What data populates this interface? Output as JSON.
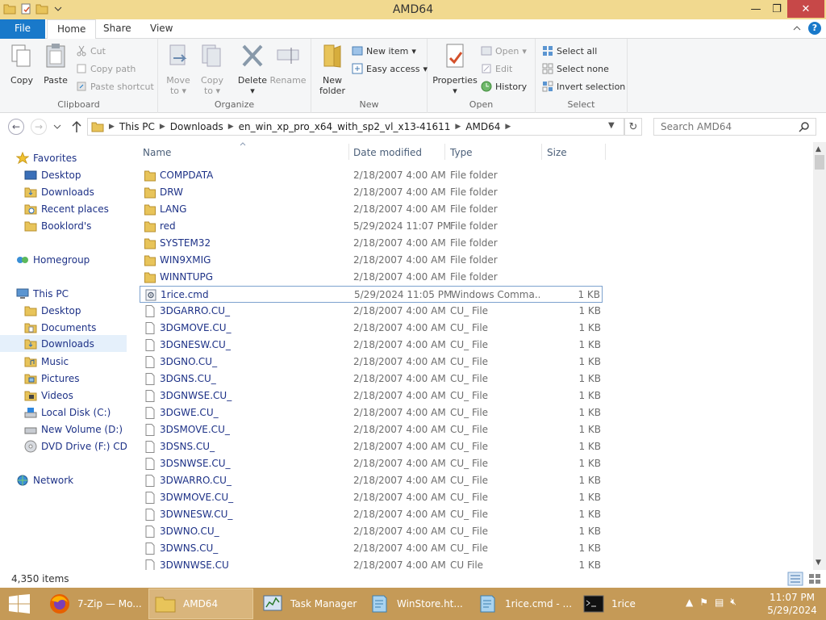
{
  "window": {
    "title": "AMD64",
    "min_glyph": "—",
    "max_glyph": "❐",
    "close_glyph": "✕"
  },
  "tabs": {
    "file": "File",
    "home": "Home",
    "share": "Share",
    "view": "View"
  },
  "ribbon": {
    "clipboard": {
      "label": "Clipboard",
      "copy": "Copy",
      "paste": "Paste",
      "cut": "Cut",
      "copy_path": "Copy path",
      "paste_shortcut": "Paste shortcut"
    },
    "organize": {
      "label": "Organize",
      "move_to": "Move",
      "move_to2": "to",
      "copy_to": "Copy",
      "copy_to2": "to",
      "delete": "Delete",
      "rename": "Rename"
    },
    "new": {
      "label": "New",
      "new_folder": "New",
      "new_folder2": "folder",
      "new_item": "New item",
      "easy_access": "Easy access"
    },
    "open": {
      "label": "Open",
      "properties": "Properties",
      "open": "Open",
      "edit": "Edit",
      "history": "History"
    },
    "select": {
      "label": "Select",
      "select_all": "Select all",
      "select_none": "Select none",
      "invert": "Invert selection"
    }
  },
  "address": {
    "segments": [
      "This PC",
      "Downloads",
      "en_win_xp_pro_x64_with_sp2_vl_x13-41611",
      "AMD64"
    ],
    "search_placeholder": "Search AMD64"
  },
  "navpane": {
    "favorites": "Favorites",
    "fav_items": [
      "Desktop",
      "Downloads",
      "Recent places",
      "Booklord's"
    ],
    "homegroup": "Homegroup",
    "thispc": "This PC",
    "pc_items": [
      "Desktop",
      "Documents",
      "Downloads",
      "Music",
      "Pictures",
      "Videos",
      "Local Disk (C:)",
      "New Volume (D:)",
      "DVD Drive (F:) CD_R"
    ],
    "network": "Network"
  },
  "columns": {
    "name": "Name",
    "date": "Date modified",
    "type": "Type",
    "size": "Size"
  },
  "files": [
    {
      "name": "COMPDATA",
      "date": "2/18/2007 4:00 AM",
      "type": "File folder",
      "size": "",
      "kind": "folder"
    },
    {
      "name": "DRW",
      "date": "2/18/2007 4:00 AM",
      "type": "File folder",
      "size": "",
      "kind": "folder"
    },
    {
      "name": "LANG",
      "date": "2/18/2007 4:00 AM",
      "type": "File folder",
      "size": "",
      "kind": "folder"
    },
    {
      "name": "red",
      "date": "5/29/2024 11:07 PM",
      "type": "File folder",
      "size": "",
      "kind": "folder"
    },
    {
      "name": "SYSTEM32",
      "date": "2/18/2007 4:00 AM",
      "type": "File folder",
      "size": "",
      "kind": "folder"
    },
    {
      "name": "WIN9XMIG",
      "date": "2/18/2007 4:00 AM",
      "type": "File folder",
      "size": "",
      "kind": "folder"
    },
    {
      "name": "WINNTUPG",
      "date": "2/18/2007 4:00 AM",
      "type": "File folder",
      "size": "",
      "kind": "folder"
    },
    {
      "name": "1rice.cmd",
      "date": "5/29/2024 11:05 PM",
      "type": "Windows Comma...",
      "size": "1 KB",
      "kind": "cmd"
    },
    {
      "name": "3DGARRO.CU_",
      "date": "2/18/2007 4:00 AM",
      "type": "CU_ File",
      "size": "1 KB",
      "kind": "file"
    },
    {
      "name": "3DGMOVE.CU_",
      "date": "2/18/2007 4:00 AM",
      "type": "CU_ File",
      "size": "1 KB",
      "kind": "file"
    },
    {
      "name": "3DGNESW.CU_",
      "date": "2/18/2007 4:00 AM",
      "type": "CU_ File",
      "size": "1 KB",
      "kind": "file"
    },
    {
      "name": "3DGNO.CU_",
      "date": "2/18/2007 4:00 AM",
      "type": "CU_ File",
      "size": "1 KB",
      "kind": "file"
    },
    {
      "name": "3DGNS.CU_",
      "date": "2/18/2007 4:00 AM",
      "type": "CU_ File",
      "size": "1 KB",
      "kind": "file"
    },
    {
      "name": "3DGNWSE.CU_",
      "date": "2/18/2007 4:00 AM",
      "type": "CU_ File",
      "size": "1 KB",
      "kind": "file"
    },
    {
      "name": "3DGWE.CU_",
      "date": "2/18/2007 4:00 AM",
      "type": "CU_ File",
      "size": "1 KB",
      "kind": "file"
    },
    {
      "name": "3DSMOVE.CU_",
      "date": "2/18/2007 4:00 AM",
      "type": "CU_ File",
      "size": "1 KB",
      "kind": "file"
    },
    {
      "name": "3DSNS.CU_",
      "date": "2/18/2007 4:00 AM",
      "type": "CU_ File",
      "size": "1 KB",
      "kind": "file"
    },
    {
      "name": "3DSNWSE.CU_",
      "date": "2/18/2007 4:00 AM",
      "type": "CU_ File",
      "size": "1 KB",
      "kind": "file"
    },
    {
      "name": "3DWARRO.CU_",
      "date": "2/18/2007 4:00 AM",
      "type": "CU_ File",
      "size": "1 KB",
      "kind": "file"
    },
    {
      "name": "3DWMOVE.CU_",
      "date": "2/18/2007 4:00 AM",
      "type": "CU_ File",
      "size": "1 KB",
      "kind": "file"
    },
    {
      "name": "3DWNESW.CU_",
      "date": "2/18/2007 4:00 AM",
      "type": "CU_ File",
      "size": "1 KB",
      "kind": "file"
    },
    {
      "name": "3DWNO.CU_",
      "date": "2/18/2007 4:00 AM",
      "type": "CU_ File",
      "size": "1 KB",
      "kind": "file"
    },
    {
      "name": "3DWNS.CU_",
      "date": "2/18/2007 4:00 AM",
      "type": "CU_ File",
      "size": "1 KB",
      "kind": "file"
    },
    {
      "name": "3DWNWSE.CU",
      "date": "2/18/2007 4:00 AM",
      "type": "CU  File",
      "size": "1 KB",
      "kind": "file"
    }
  ],
  "status": {
    "item_count": "4,350 items"
  },
  "taskbar": {
    "items": [
      {
        "label": "7-Zip — Mo...",
        "icon": "firefox-icon"
      },
      {
        "label": "AMD64",
        "icon": "folder-icon",
        "active": true
      },
      {
        "label": "Task Manager",
        "icon": "task-manager-icon"
      },
      {
        "label": "WinStore.ht...",
        "icon": "notepad-icon"
      },
      {
        "label": "1rice.cmd - ...",
        "icon": "notepad-icon"
      },
      {
        "label": "1rice",
        "icon": "cmd-icon"
      }
    ],
    "time": "11:07 PM",
    "date": "5/29/2024"
  },
  "colors": {
    "titlebar": "#f1d98f",
    "file_tab": "#1979ca",
    "taskbar": "#c59a57",
    "link": "#1e3287",
    "folder": "#e8c45a"
  }
}
